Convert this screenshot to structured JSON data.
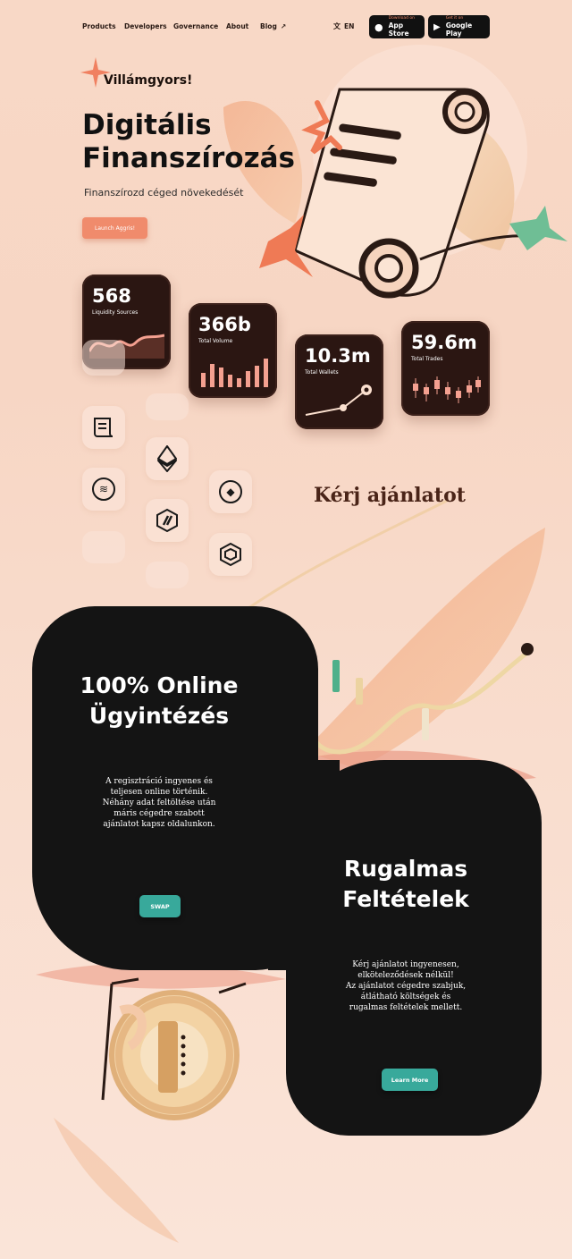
{
  "nav": {
    "links": [
      "Products",
      "Developers",
      "Governance",
      "About",
      "Blog"
    ],
    "language": "EN",
    "app_store": {
      "small": "Download on",
      "big": "App Store"
    },
    "google_play": {
      "small": "Get it on",
      "big": "Google Play"
    }
  },
  "hero": {
    "brand": "Villámgyors!",
    "title_line1": "Digitális",
    "title_line2": "Finanszírozás",
    "subtitle": "Finanszírozd céged növekedését",
    "launch_button": "Launch Aggris!"
  },
  "stats": [
    {
      "value": "568",
      "label": "Liquidity Sources"
    },
    {
      "value": "366b",
      "label": "Total Volume"
    },
    {
      "value": "10.3m",
      "label": "Total Wallets"
    },
    {
      "value": "59.6m",
      "label": "Total Trades"
    }
  ],
  "icons": [
    "scroll-icon",
    "ethereum-icon",
    "swap-coin-icon",
    "diamond-coin-icon",
    "hexagon-coin-icon",
    "cube-coin-icon"
  ],
  "cta_heading": "Kérj ajánlatot",
  "panel_online": {
    "title_line1": "100% Online",
    "title_line2": "Ügyintézés",
    "text": [
      "A regisztráció ingyenes és",
      "teljesen online történik.",
      "Néhány adat feltöltése után",
      "máris cégedre szabott",
      "ajánlatot kapsz oldalunkon."
    ],
    "button": "SWAP"
  },
  "panel_flexible": {
    "title_line1": "Rugalmas",
    "title_line2": "Feltételek",
    "text": [
      "Kérj ajánlatot ingyenesen,",
      "elköteleződések nélkül!",
      "Az ajánlatot cégedre szabjuk,",
      "átlátható költségek és",
      "rugalmas feltételek mellett."
    ],
    "button": "Learn More"
  },
  "colors": {
    "accent": "#f08b6c",
    "dark": "#141414",
    "card": "#2b1612",
    "teal": "#38a99b"
  }
}
